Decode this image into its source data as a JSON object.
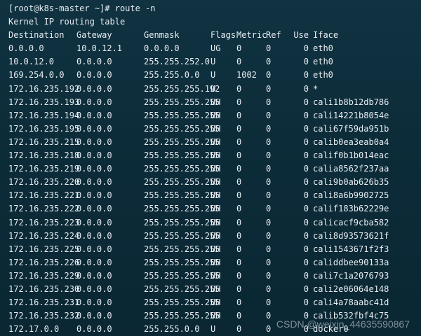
{
  "terminal": {
    "prompt_line": "[root@k8s-master ~]# route -n",
    "table_title": "Kernel IP routing table",
    "headers": {
      "destination": "Destination",
      "gateway": "Gateway",
      "genmask": "Genmask",
      "flags": "Flags",
      "metric": "Metric",
      "ref": "Ref",
      "use": "Use",
      "iface": "Iface"
    },
    "rows": [
      {
        "destination": "0.0.0.0",
        "gateway": "10.0.12.1",
        "genmask": "0.0.0.0",
        "flags": "UG",
        "metric": "0",
        "ref": "0",
        "use": "0",
        "iface": "eth0"
      },
      {
        "destination": "10.0.12.0",
        "gateway": "0.0.0.0",
        "genmask": "255.255.252.0",
        "flags": "U",
        "metric": "0",
        "ref": "0",
        "use": "0",
        "iface": "eth0"
      },
      {
        "destination": "169.254.0.0",
        "gateway": "0.0.0.0",
        "genmask": "255.255.0.0",
        "flags": "U",
        "metric": "1002",
        "ref": "0",
        "use": "0",
        "iface": "eth0"
      },
      {
        "destination": "172.16.235.192",
        "gateway": "0.0.0.0",
        "genmask": "255.255.255.192",
        "flags": "U",
        "metric": "0",
        "ref": "0",
        "use": "0",
        "iface": "*"
      },
      {
        "destination": "172.16.235.193",
        "gateway": "0.0.0.0",
        "genmask": "255.255.255.255",
        "flags": "UH",
        "metric": "0",
        "ref": "0",
        "use": "0",
        "iface": "cali1b8b12db786"
      },
      {
        "destination": "172.16.235.194",
        "gateway": "0.0.0.0",
        "genmask": "255.255.255.255",
        "flags": "UH",
        "metric": "0",
        "ref": "0",
        "use": "0",
        "iface": "cali14221b8054e"
      },
      {
        "destination": "172.16.235.195",
        "gateway": "0.0.0.0",
        "genmask": "255.255.255.255",
        "flags": "UH",
        "metric": "0",
        "ref": "0",
        "use": "0",
        "iface": "cali67f59da951b"
      },
      {
        "destination": "172.16.235.215",
        "gateway": "0.0.0.0",
        "genmask": "255.255.255.255",
        "flags": "UH",
        "metric": "0",
        "ref": "0",
        "use": "0",
        "iface": "calib0ea3eab0a4"
      },
      {
        "destination": "172.16.235.218",
        "gateway": "0.0.0.0",
        "genmask": "255.255.255.255",
        "flags": "UH",
        "metric": "0",
        "ref": "0",
        "use": "0",
        "iface": "calif0b1b014eac"
      },
      {
        "destination": "172.16.235.219",
        "gateway": "0.0.0.0",
        "genmask": "255.255.255.255",
        "flags": "UH",
        "metric": "0",
        "ref": "0",
        "use": "0",
        "iface": "calia8562f237aa"
      },
      {
        "destination": "172.16.235.220",
        "gateway": "0.0.0.0",
        "genmask": "255.255.255.255",
        "flags": "UH",
        "metric": "0",
        "ref": "0",
        "use": "0",
        "iface": "cali9b0ab626b35"
      },
      {
        "destination": "172.16.235.221",
        "gateway": "0.0.0.0",
        "genmask": "255.255.255.255",
        "flags": "UH",
        "metric": "0",
        "ref": "0",
        "use": "0",
        "iface": "cali8a6b9902725"
      },
      {
        "destination": "172.16.235.222",
        "gateway": "0.0.0.0",
        "genmask": "255.255.255.255",
        "flags": "UH",
        "metric": "0",
        "ref": "0",
        "use": "0",
        "iface": "calif183b62229e"
      },
      {
        "destination": "172.16.235.223",
        "gateway": "0.0.0.0",
        "genmask": "255.255.255.255",
        "flags": "UH",
        "metric": "0",
        "ref": "0",
        "use": "0",
        "iface": "calicacf9cba582"
      },
      {
        "destination": "172.16.235.224",
        "gateway": "0.0.0.0",
        "genmask": "255.255.255.255",
        "flags": "UH",
        "metric": "0",
        "ref": "0",
        "use": "0",
        "iface": "cali8d93573621f"
      },
      {
        "destination": "172.16.235.225",
        "gateway": "0.0.0.0",
        "genmask": "255.255.255.255",
        "flags": "UH",
        "metric": "0",
        "ref": "0",
        "use": "0",
        "iface": "cali1543671f2f3"
      },
      {
        "destination": "172.16.235.226",
        "gateway": "0.0.0.0",
        "genmask": "255.255.255.255",
        "flags": "UH",
        "metric": "0",
        "ref": "0",
        "use": "0",
        "iface": "caliddbee90133a"
      },
      {
        "destination": "172.16.235.229",
        "gateway": "0.0.0.0",
        "genmask": "255.255.255.255",
        "flags": "UH",
        "metric": "0",
        "ref": "0",
        "use": "0",
        "iface": "cali7c1a2076793"
      },
      {
        "destination": "172.16.235.230",
        "gateway": "0.0.0.0",
        "genmask": "255.255.255.255",
        "flags": "UH",
        "metric": "0",
        "ref": "0",
        "use": "0",
        "iface": "cali2e06064e148"
      },
      {
        "destination": "172.16.235.231",
        "gateway": "0.0.0.0",
        "genmask": "255.255.255.255",
        "flags": "UH",
        "metric": "0",
        "ref": "0",
        "use": "0",
        "iface": "cali4a78aabc41d"
      },
      {
        "destination": "172.16.235.232",
        "gateway": "0.0.0.0",
        "genmask": "255.255.255.255",
        "flags": "UH",
        "metric": "0",
        "ref": "0",
        "use": "0",
        "iface": "calib532fbf4c75"
      },
      {
        "destination": "172.17.0.0",
        "gateway": "0.0.0.0",
        "genmask": "255.255.0.0",
        "flags": "U",
        "metric": "0",
        "ref": "0",
        "use": "0",
        "iface": "docker0"
      }
    ]
  },
  "watermark": "CSDN @weixin_44635590867",
  "colors": {
    "background": "#0e2f3d",
    "text": "#e8eef2"
  }
}
